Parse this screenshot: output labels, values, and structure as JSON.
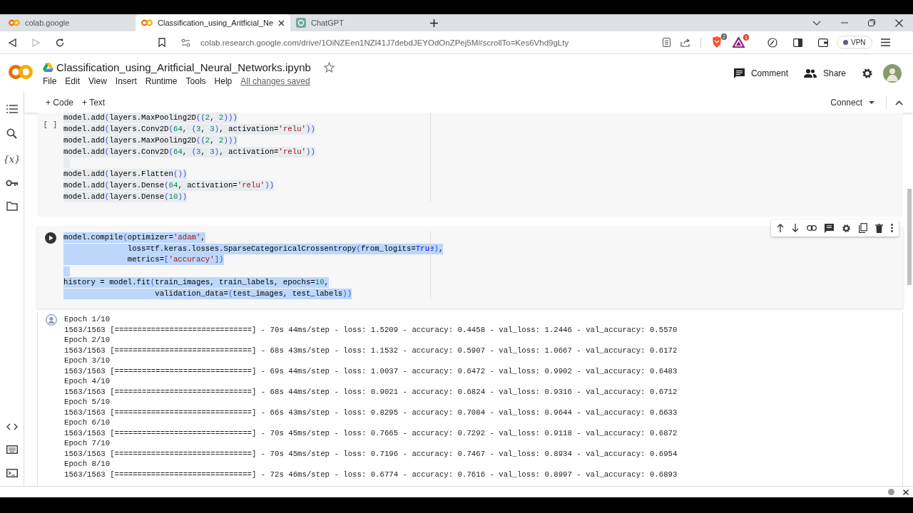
{
  "browser": {
    "tabs": [
      {
        "title": "colab.google",
        "selected": false
      },
      {
        "title": "Classification_using_Aritficial_Ne",
        "selected": true
      },
      {
        "title": "ChatGPT",
        "selected": false
      }
    ],
    "url": "colab.research.google.com/drive/1OiNZEen1NZl41J7debdJEYOdOnZPej5M#scrollTo=Kes6Vhd9gLty",
    "shield_badge": "2",
    "triangle_badge": "1",
    "vpn_label": "VPN"
  },
  "notebook": {
    "title": "Classification_using_Aritficial_Neural_Networks.ipynb",
    "menu": [
      "File",
      "Edit",
      "View",
      "Insert",
      "Runtime",
      "Tools",
      "Help"
    ],
    "save_status": "All changes saved",
    "comment_label": "Comment",
    "share_label": "Share"
  },
  "toolbar": {
    "add_buttons": [
      "+ Code",
      "+ Text"
    ],
    "connect_label": "Connect"
  },
  "sidebar": {
    "variables_glyph": "{x}"
  },
  "cells": [
    {
      "kind": "code",
      "focused": false,
      "execution_label": "[ ]",
      "lines": [
        {
          "kind": "code",
          "text": "model.add(layers.MaxPooling2D((2, 2)))"
        },
        {
          "kind": "code",
          "text": "model.add(layers.Conv2D(64, (3, 3), activation='relu'))"
        },
        {
          "kind": "code",
          "text": "model.add(layers.MaxPooling2D((2, 2)))"
        },
        {
          "kind": "code",
          "text": "model.add(layers.Conv2D(64, (3, 3), activation='relu'))"
        },
        {
          "kind": "blank"
        },
        {
          "kind": "code",
          "text": "model.add(layers.Flatten())"
        },
        {
          "kind": "code",
          "text": "model.add(layers.Dense(64, activation='relu'))"
        },
        {
          "kind": "code",
          "text": "model.add(layers.Dense(10))"
        }
      ]
    },
    {
      "kind": "code",
      "focused": true,
      "lines": [
        {
          "kind": "code",
          "text": "model.compile(optimizer='adam',"
        },
        {
          "kind": "code",
          "text": "              loss=tf.keras.losses.SparseCategoricalCrossentropy(from_logits=True),"
        },
        {
          "kind": "code",
          "text": "              metrics=['accuracy'])"
        },
        {
          "kind": "blank"
        },
        {
          "kind": "code",
          "text": "history = model.fit(train_images, train_labels, epochs=10,"
        },
        {
          "kind": "code",
          "text": "                    validation_data=(test_images, test_labels))"
        }
      ],
      "output": [
        "Epoch 1/10",
        "1563/1563 [==============================] - 70s 44ms/step - loss: 1.5209 - accuracy: 0.4458 - val_loss: 1.2446 - val_accuracy: 0.5570",
        "Epoch 2/10",
        "1563/1563 [==============================] - 68s 43ms/step - loss: 1.1532 - accuracy: 0.5907 - val_loss: 1.0667 - val_accuracy: 0.6172",
        "Epoch 3/10",
        "1563/1563 [==============================] - 69s 44ms/step - loss: 1.0037 - accuracy: 0.6472 - val_loss: 0.9902 - val_accuracy: 0.6483",
        "Epoch 4/10",
        "1563/1563 [==============================] - 68s 44ms/step - loss: 0.9021 - accuracy: 0.6824 - val_loss: 0.9316 - val_accuracy: 0.6712",
        "Epoch 5/10",
        "1563/1563 [==============================] - 66s 43ms/step - loss: 0.8295 - accuracy: 0.7084 - val_loss: 0.9644 - val_accuracy: 0.6633",
        "Epoch 6/10",
        "1563/1563 [==============================] - 70s 45ms/step - loss: 0.7665 - accuracy: 0.7292 - val_loss: 0.9118 - val_accuracy: 0.6872",
        "Epoch 7/10",
        "1563/1563 [==============================] - 70s 45ms/step - loss: 0.7196 - accuracy: 0.7467 - val_loss: 0.8934 - val_accuracy: 0.6954",
        "Epoch 8/10",
        "1563/1563 [==============================] - 72s 46ms/step - loss: 0.6774 - accuracy: 0.7616 - val_loss: 0.8997 - val_accuracy: 0.6893"
      ]
    }
  ]
}
